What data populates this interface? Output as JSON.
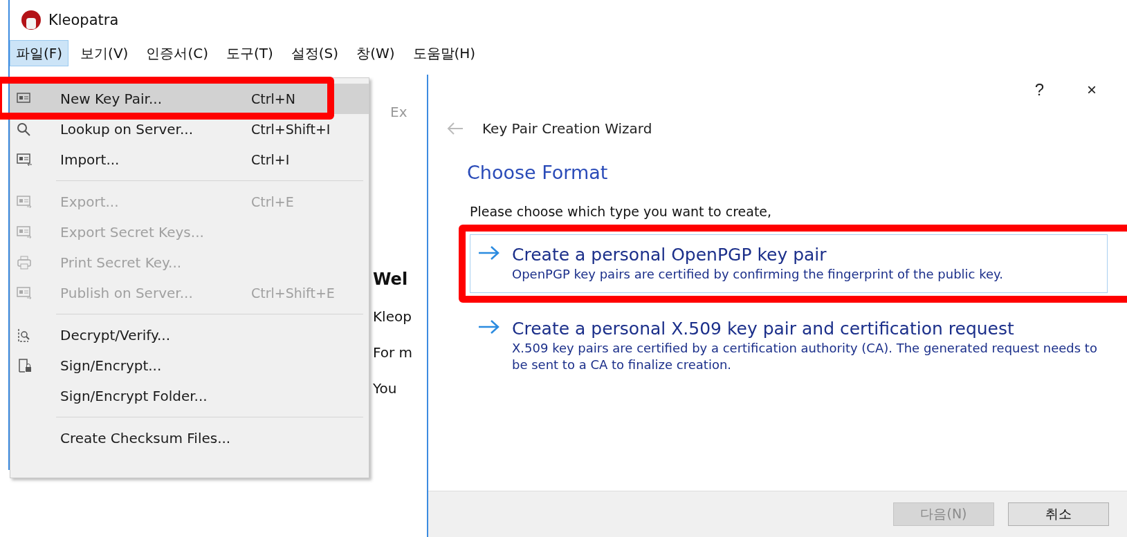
{
  "main_window": {
    "title": "Kleopatra",
    "menubar": [
      {
        "label": "파일(F)",
        "selected": true
      },
      {
        "label": "보기(V)",
        "selected": false
      },
      {
        "label": "인증서(C)",
        "selected": false
      },
      {
        "label": "도구(T)",
        "selected": false
      },
      {
        "label": "설정(S)",
        "selected": false
      },
      {
        "label": "창(W)",
        "selected": false
      },
      {
        "label": "도움말(H)",
        "selected": false
      }
    ],
    "toolbar": [
      {
        "label": "Ex"
      }
    ],
    "content": [
      {
        "kind": "heading",
        "text": "Wel"
      },
      {
        "kind": "line",
        "text": "Kleop"
      },
      {
        "kind": "line",
        "text": "For m"
      },
      {
        "kind": "line",
        "text": "You"
      }
    ]
  },
  "file_menu": [
    {
      "kind": "item",
      "label": "New Key Pair...",
      "shortcut": "Ctrl+N",
      "disabled": false,
      "selected": true,
      "highlighted": true
    },
    {
      "kind": "item",
      "label": "Lookup on Server...",
      "shortcut": "Ctrl+Shift+I",
      "disabled": false,
      "selected": false,
      "highlighted": false
    },
    {
      "kind": "item",
      "label": "Import...",
      "shortcut": "Ctrl+I",
      "disabled": false,
      "selected": false,
      "highlighted": false
    },
    {
      "kind": "separator"
    },
    {
      "kind": "item",
      "label": "Export...",
      "shortcut": "Ctrl+E",
      "disabled": true,
      "selected": false,
      "highlighted": false
    },
    {
      "kind": "item",
      "label": "Export Secret Keys...",
      "disabled": true,
      "selected": false,
      "highlighted": false
    },
    {
      "kind": "item",
      "label": "Print Secret Key...",
      "disabled": true,
      "selected": false,
      "highlighted": false
    },
    {
      "kind": "item",
      "label": "Publish on Server...",
      "shortcut": "Ctrl+Shift+E",
      "disabled": true,
      "selected": false,
      "highlighted": false
    },
    {
      "kind": "separator"
    },
    {
      "kind": "item",
      "label": "Decrypt/Verify...",
      "disabled": false,
      "selected": false,
      "highlighted": false
    },
    {
      "kind": "item",
      "label": "Sign/Encrypt...",
      "disabled": false,
      "selected": false,
      "highlighted": false
    },
    {
      "kind": "item",
      "label": "Sign/Encrypt Folder...",
      "disabled": false,
      "selected": false,
      "highlighted": false
    },
    {
      "kind": "separator"
    },
    {
      "kind": "item",
      "label": "Create Checksum Files...",
      "disabled": false,
      "selected": false,
      "highlighted": false
    }
  ],
  "dialog": {
    "help": "?",
    "close": "×",
    "title": "Key Pair Creation Wizard",
    "heading": "Choose Format",
    "prompt": "Please choose which type you want to create,",
    "options": [
      {
        "title": "Create a personal OpenPGP key pair",
        "description": "OpenPGP key pairs are certified by confirming the fingerprint of the public key.",
        "selected": true,
        "highlighted": true
      },
      {
        "title": "Create a personal X.509 key pair and certification request",
        "description": "X.509 key pairs are certified by a certification authority (CA). The generated request needs to be sent to a CA to finalize creation.",
        "selected": false,
        "highlighted": false
      }
    ],
    "buttons": [
      {
        "label": "다음(N)",
        "disabled": true
      },
      {
        "label": "취소",
        "disabled": false
      }
    ]
  }
}
